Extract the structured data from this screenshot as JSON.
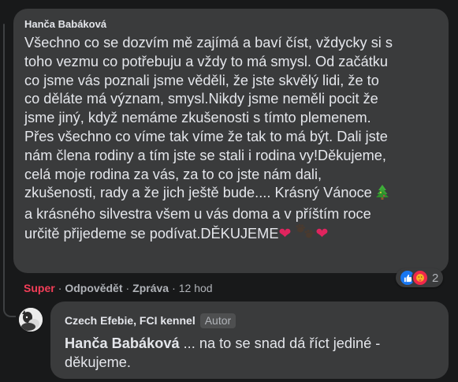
{
  "comment": {
    "author": "Hanča Babáková",
    "lines": [
      "Všechno co se dozvím mě zajímá a baví číst, vždycky si s",
      "toho vezmu co potřebuju a vždy to má smysl. Od začátku",
      "co jsme vás poznali jsme věděli, že jste skvělý lidi, že to",
      "co děláte má význam, smysl.Nikdy jsme neměli pocit že",
      "jsme jiný, když nemáme zkušenosti s tímto plemenem.",
      "Přes všechno co víme tak víme že tak to má být. Dali jste",
      "nám člena rodiny a tím jste se stali i rodina vy!Děkujeme,",
      "celá moje rodina za vás, za to co jste nám dali,",
      "zkušenosti, rady a že jich ještě bude.... Krásný Vánoce",
      "a krásného silvestra všem u vás doma a v příštím roce",
      "určitě přijedeme se podívat.DĚKUJEME"
    ],
    "emojis": [
      "christmas-tree",
      "red-heart",
      "paw-prints",
      "red-heart"
    ],
    "heart_glyph": "❤",
    "reaction_count": "2",
    "reactions": [
      "like",
      "care"
    ],
    "actions": {
      "reaction_label": "Super",
      "reply_label": "Odpovědět",
      "message_label": "Zpráva",
      "separator": "·",
      "time": "12 hod"
    }
  },
  "reply": {
    "author": "Czech Efebie, FCI kennel",
    "author_badge": "Autor",
    "mention": "Hanča Babáková",
    "line1_rest": " ... na to se snad dá říct jediné -",
    "line2": "děkujeme."
  },
  "colors": {
    "background": "#18191a",
    "bubble": "#3a3b3c",
    "text": "#e4e6eb",
    "secondary_text": "#b0b3b8",
    "super_reaction": "#f33e58",
    "like_blue": "#1877f2",
    "heart_red": "#e0245e"
  }
}
